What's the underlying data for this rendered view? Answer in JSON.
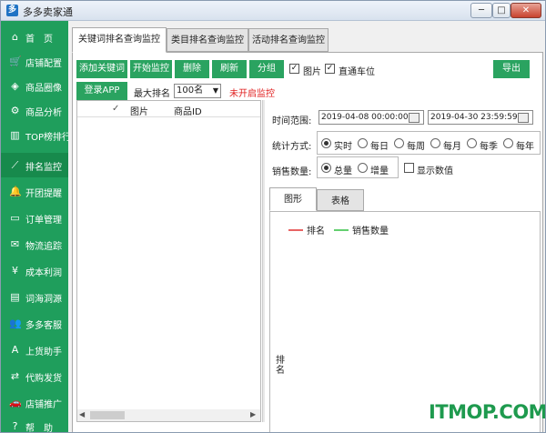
{
  "window": {
    "title": "多多卖家通",
    "min_label": "─",
    "max_label": "□",
    "close_label": "✕"
  },
  "sidebar": {
    "items": [
      {
        "label": "首　页",
        "icon": "home-icon",
        "glyph": "⌂"
      },
      {
        "label": "店铺配置",
        "icon": "cart-icon",
        "glyph": "🛒"
      },
      {
        "label": "商品圈像",
        "icon": "cube-icon",
        "glyph": "◈"
      },
      {
        "label": "商品分析",
        "icon": "analysis-icon",
        "glyph": "⚙"
      },
      {
        "label": "TOP榜排行",
        "icon": "bar-chart-icon",
        "glyph": "▥"
      },
      {
        "label": "排名监控",
        "icon": "line-chart-icon",
        "glyph": "⟋"
      },
      {
        "label": "开团提醒",
        "icon": "bell-icon",
        "glyph": "🔔"
      },
      {
        "label": "订单管理",
        "icon": "folder-icon",
        "glyph": "▭"
      },
      {
        "label": "物流追踪",
        "icon": "envelope-icon",
        "glyph": "✉"
      },
      {
        "label": "成本利润",
        "icon": "yen-icon",
        "glyph": "¥"
      },
      {
        "label": "词海洞源",
        "icon": "book-icon",
        "glyph": "▤"
      },
      {
        "label": "多多客服",
        "icon": "users-icon",
        "glyph": "👥"
      },
      {
        "label": "上货助手",
        "icon": "font-icon",
        "glyph": "A"
      },
      {
        "label": "代购发货",
        "icon": "exchange-icon",
        "glyph": "⇄"
      },
      {
        "label": "店铺推广",
        "icon": "car-icon",
        "glyph": "🚗"
      },
      {
        "label": "帮　助",
        "icon": "help-icon",
        "glyph": "?"
      }
    ]
  },
  "tabs": [
    {
      "label": "关键词排名查询监控"
    },
    {
      "label": "类目排名查询监控"
    },
    {
      "label": "活动排名查询监控"
    }
  ],
  "toolbar": {
    "add_keyword": "添加关键词",
    "start_monitor": "开始监控",
    "delete": "删除",
    "refresh": "刷新",
    "group": "分组",
    "image_label": "图片",
    "image_checked": "✓",
    "direct_car_label": "直通车位",
    "direct_car_checked": "✓",
    "export": "导出",
    "login_app": "登录APP",
    "max_rank_label": "最大排名",
    "max_rank_value": "100名",
    "status_text": "未开启监控",
    "status_color": "#e02020"
  },
  "grid": {
    "columns": [
      "",
      "✓",
      "图片",
      "商品ID"
    ]
  },
  "stats": {
    "time_range_label": "时间范围:",
    "start_time": "2019-04-08 00:00:00",
    "end_time": "2019-04-30 23:59:59",
    "mode_label": "统计方式:",
    "modes": [
      "实时",
      "每日",
      "每周",
      "每月",
      "每季",
      "每年"
    ],
    "selected_mode": 0,
    "sales_label": "销售数量:",
    "sales_options": [
      "总量",
      "增量"
    ],
    "selected_sales": 0,
    "show_values_label": "显示数值"
  },
  "inner_tabs": [
    "图形",
    "表格"
  ],
  "chart_data": {
    "type": "line",
    "series": [
      {
        "name": "排名",
        "values": []
      },
      {
        "name": "销售数量",
        "values": []
      }
    ],
    "colors": [
      "#e03030",
      "#30c040"
    ],
    "ylabel": "排名",
    "legend": "top-left"
  },
  "watermark": "ITMOP.COM"
}
